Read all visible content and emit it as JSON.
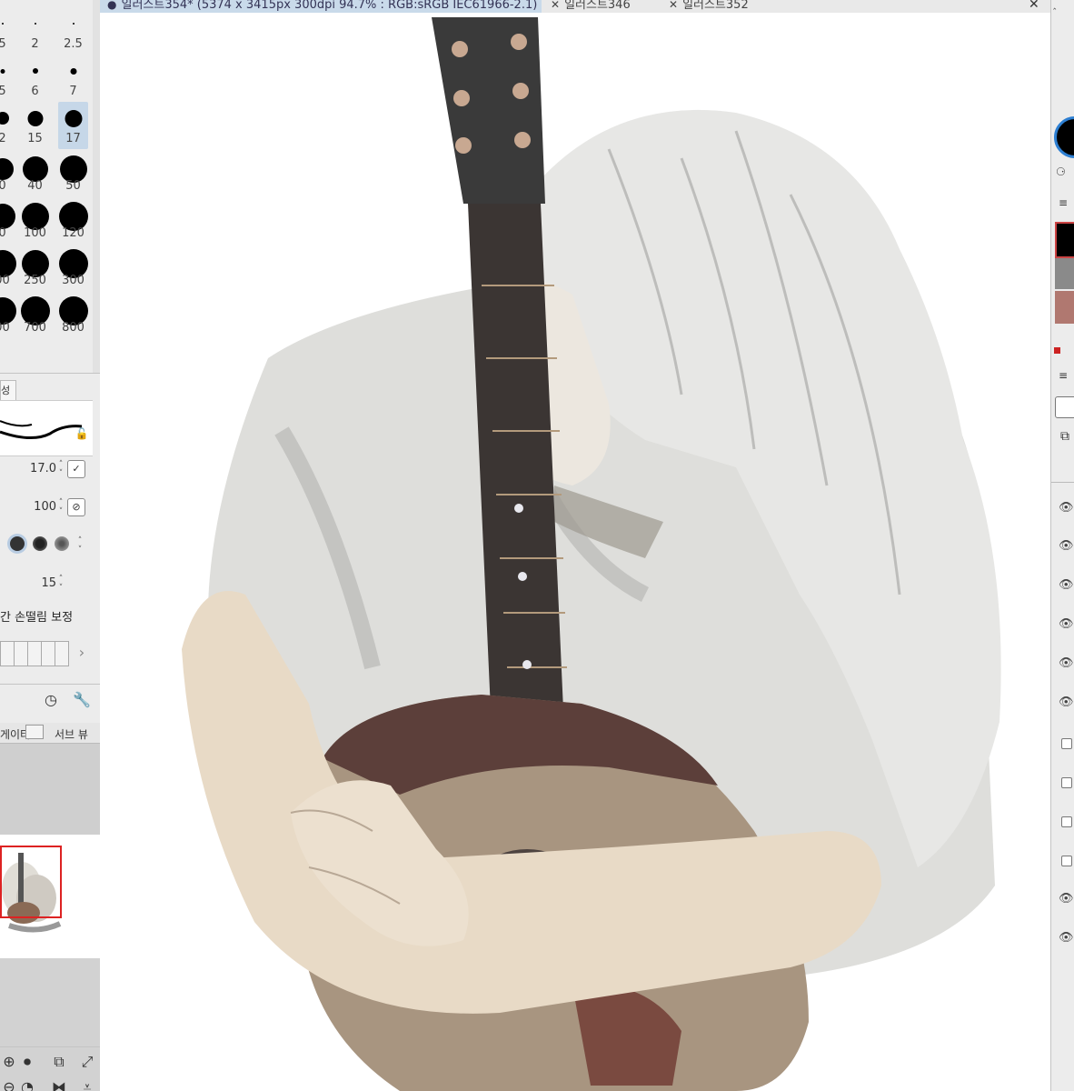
{
  "tabs": [
    {
      "label": "일러스트354* (5374 x 3415px 300dpi 94.7% : RGB:sRGB IEC61966-2.1)",
      "active": true
    },
    {
      "label": "일러스트346",
      "active": false
    },
    {
      "label": "일러스트352",
      "active": false
    }
  ],
  "brush_sizes": {
    "rows": [
      [
        "5",
        "2",
        "2.5"
      ],
      [
        "5",
        "6",
        "7"
      ],
      [
        "2",
        "15",
        "17"
      ],
      [
        "0",
        "40",
        "50"
      ],
      [
        "0",
        "100",
        "120"
      ],
      [
        "00",
        "250",
        "300"
      ],
      [
        "00",
        "700",
        "800"
      ]
    ],
    "selected": "17"
  },
  "tool_property": {
    "tab_label": "성",
    "brush_size": "17.0",
    "opacity": "100",
    "stabilization": "15",
    "stabilization_label": "손떨림 보정",
    "stab_prefix": "간"
  },
  "navigator": {
    "tab_label": "게이터",
    "sub_view_label": "서브 뷰"
  },
  "colors": {
    "main": "#000000",
    "swatch_gray": "#8a8a8a",
    "swatch_brown": "#b07870",
    "accent": "#c9daea"
  }
}
